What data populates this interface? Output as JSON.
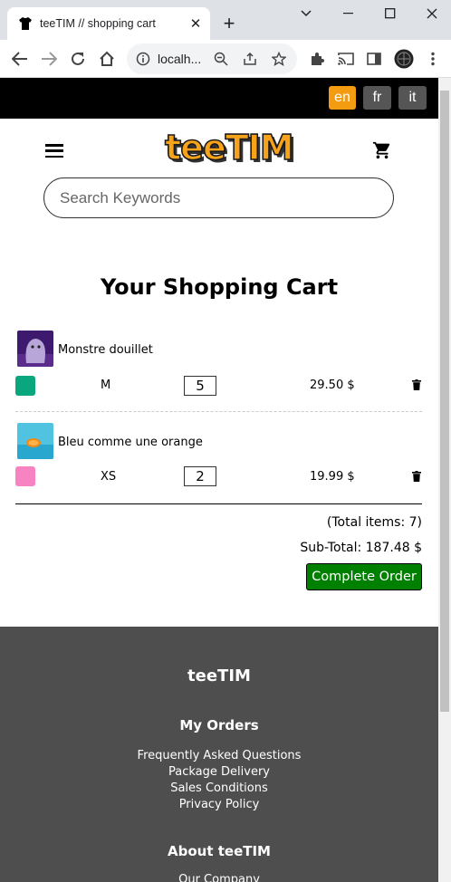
{
  "browser": {
    "tab_title": "teeTIM // shopping cart",
    "url": "localh..."
  },
  "languages": [
    {
      "code": "en",
      "active": true
    },
    {
      "code": "fr",
      "active": false
    },
    {
      "code": "it",
      "active": false
    }
  ],
  "header": {
    "logo": "teeTIM",
    "search_placeholder": "Search Keywords"
  },
  "cart": {
    "title": "Your Shopping Cart",
    "items": [
      {
        "name": "Monstre douillet",
        "color": "#0aa67e",
        "size": "M",
        "quantity": "5",
        "price": "29.50 $"
      },
      {
        "name": "Bleu comme une orange",
        "color": "#f783c3",
        "size": "XS",
        "quantity": "2",
        "price": "19.99 $"
      }
    ],
    "total_items": "(Total items: 7)",
    "subtotal": "Sub-Total: 187.48 $",
    "complete_order": "Complete Order"
  },
  "footer": {
    "brand": "teeTIM",
    "section1_title": "My Orders",
    "links": [
      "Frequently Asked Questions",
      "Package Delivery",
      "Sales Conditions",
      "Privacy Policy"
    ],
    "section2_title": "About teeTIM",
    "section2_first": "Our Company"
  },
  "colors": {
    "accent_lang": "#f39c12",
    "order_button": "#008000",
    "footer_bg": "#4e4e4e"
  }
}
